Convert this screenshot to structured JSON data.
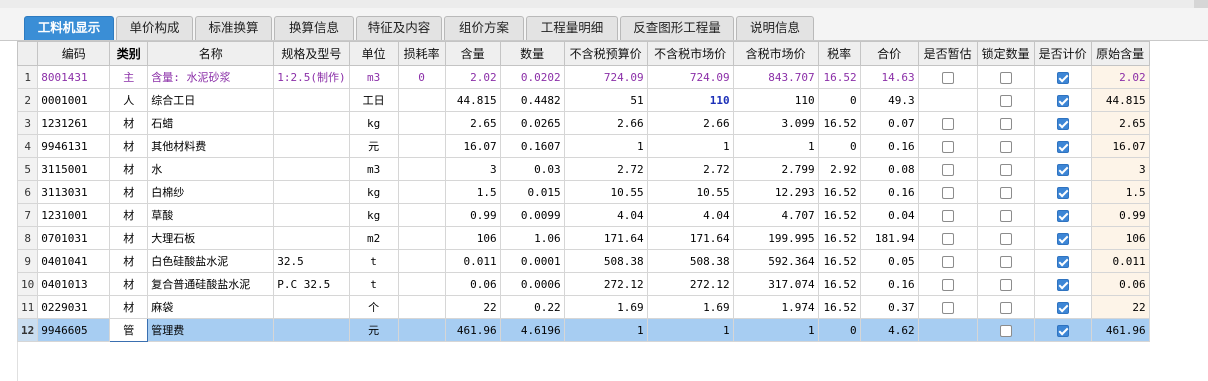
{
  "tabs": [
    {
      "label": "工料机显示",
      "active": true
    },
    {
      "label": "单价构成",
      "active": false
    },
    {
      "label": "标准换算",
      "active": false
    },
    {
      "label": "换算信息",
      "active": false
    },
    {
      "label": "特征及内容",
      "active": false
    },
    {
      "label": "组价方案",
      "active": false
    },
    {
      "label": "工程量明细",
      "active": false
    },
    {
      "label": "反查图形工程量",
      "active": false
    },
    {
      "label": "说明信息",
      "active": false
    }
  ],
  "columns": [
    "编码",
    "类别",
    "名称",
    "规格及型号",
    "单位",
    "损耗率",
    "含量",
    "数量",
    "不含税预算价",
    "不含税市场价",
    "含税市场价",
    "税率",
    "合价",
    "是否暂估",
    "锁定数量",
    "是否计价",
    "原始含量"
  ],
  "rows": [
    {
      "no": "1",
      "code": "8001431",
      "type": "主",
      "name": "含量: 水泥砂浆",
      "spec": "1:2.5(制作)",
      "unit": "m3",
      "loss": "0",
      "qty": "2.02",
      "amount": "0.0202",
      "pre_price": "724.09",
      "mkt_price": "724.09",
      "tax_price": "843.707",
      "tax_rate": "16.52",
      "total": "14.63",
      "estimated": false,
      "locked": false,
      "priced": true,
      "orig_qty": "2.02"
    },
    {
      "no": "2",
      "code": "0001001",
      "type": "人",
      "name": "综合工日",
      "spec": "",
      "unit": "工日",
      "loss": "",
      "qty": "44.815",
      "amount": "0.4482",
      "pre_price": "51",
      "mkt_price": "110",
      "tax_price": "110",
      "tax_rate": "0",
      "total": "49.3",
      "estimated": null,
      "locked": false,
      "priced": true,
      "orig_qty": "44.815"
    },
    {
      "no": "3",
      "code": "1231261",
      "type": "材",
      "name": "石蜡",
      "spec": "",
      "unit": "kg",
      "loss": "",
      "qty": "2.65",
      "amount": "0.0265",
      "pre_price": "2.66",
      "mkt_price": "2.66",
      "tax_price": "3.099",
      "tax_rate": "16.52",
      "total": "0.07",
      "estimated": false,
      "locked": false,
      "priced": true,
      "orig_qty": "2.65"
    },
    {
      "no": "4",
      "code": "9946131",
      "type": "材",
      "name": "其他材料费",
      "spec": "",
      "unit": "元",
      "loss": "",
      "qty": "16.07",
      "amount": "0.1607",
      "pre_price": "1",
      "mkt_price": "1",
      "tax_price": "1",
      "tax_rate": "0",
      "total": "0.16",
      "estimated": false,
      "locked": false,
      "priced": true,
      "orig_qty": "16.07"
    },
    {
      "no": "5",
      "code": "3115001",
      "type": "材",
      "name": "水",
      "spec": "",
      "unit": "m3",
      "loss": "",
      "qty": "3",
      "amount": "0.03",
      "pre_price": "2.72",
      "mkt_price": "2.72",
      "tax_price": "2.799",
      "tax_rate": "2.92",
      "total": "0.08",
      "estimated": false,
      "locked": false,
      "priced": true,
      "orig_qty": "3"
    },
    {
      "no": "6",
      "code": "3113031",
      "type": "材",
      "name": "白棉纱",
      "spec": "",
      "unit": "kg",
      "loss": "",
      "qty": "1.5",
      "amount": "0.015",
      "pre_price": "10.55",
      "mkt_price": "10.55",
      "tax_price": "12.293",
      "tax_rate": "16.52",
      "total": "0.16",
      "estimated": false,
      "locked": false,
      "priced": true,
      "orig_qty": "1.5"
    },
    {
      "no": "7",
      "code": "1231001",
      "type": "材",
      "name": "草酸",
      "spec": "",
      "unit": "kg",
      "loss": "",
      "qty": "0.99",
      "amount": "0.0099",
      "pre_price": "4.04",
      "mkt_price": "4.04",
      "tax_price": "4.707",
      "tax_rate": "16.52",
      "total": "0.04",
      "estimated": false,
      "locked": false,
      "priced": true,
      "orig_qty": "0.99"
    },
    {
      "no": "8",
      "code": "0701031",
      "type": "材",
      "name": "大理石板",
      "spec": "",
      "unit": "m2",
      "loss": "",
      "qty": "106",
      "amount": "1.06",
      "pre_price": "171.64",
      "mkt_price": "171.64",
      "tax_price": "199.995",
      "tax_rate": "16.52",
      "total": "181.94",
      "estimated": false,
      "locked": false,
      "priced": true,
      "orig_qty": "106"
    },
    {
      "no": "9",
      "code": "0401041",
      "type": "材",
      "name": "白色硅酸盐水泥",
      "spec": "32.5",
      "unit": "t",
      "loss": "",
      "qty": "0.011",
      "amount": "0.0001",
      "pre_price": "508.38",
      "mkt_price": "508.38",
      "tax_price": "592.364",
      "tax_rate": "16.52",
      "total": "0.05",
      "estimated": false,
      "locked": false,
      "priced": true,
      "orig_qty": "0.011"
    },
    {
      "no": "10",
      "code": "0401013",
      "type": "材",
      "name": "复合普通硅酸盐水泥",
      "spec": "P.C 32.5",
      "unit": "t",
      "loss": "",
      "qty": "0.06",
      "amount": "0.0006",
      "pre_price": "272.12",
      "mkt_price": "272.12",
      "tax_price": "317.074",
      "tax_rate": "16.52",
      "total": "0.16",
      "estimated": false,
      "locked": false,
      "priced": true,
      "orig_qty": "0.06"
    },
    {
      "no": "11",
      "code": "0229031",
      "type": "材",
      "name": "麻袋",
      "spec": "",
      "unit": "个",
      "loss": "",
      "qty": "22",
      "amount": "0.22",
      "pre_price": "1.69",
      "mkt_price": "1.69",
      "tax_price": "1.974",
      "tax_rate": "16.52",
      "total": "0.37",
      "estimated": false,
      "locked": false,
      "priced": true,
      "orig_qty": "22"
    },
    {
      "no": "12",
      "code": "9946605",
      "type": "管",
      "name": "管理费",
      "spec": "",
      "unit": "元",
      "loss": "",
      "qty": "461.96",
      "amount": "4.6196",
      "pre_price": "1",
      "mkt_price": "1",
      "tax_price": "1",
      "tax_rate": "0",
      "total": "4.62",
      "estimated": null,
      "locked": false,
      "priced": true,
      "orig_qty": "461.96"
    }
  ]
}
